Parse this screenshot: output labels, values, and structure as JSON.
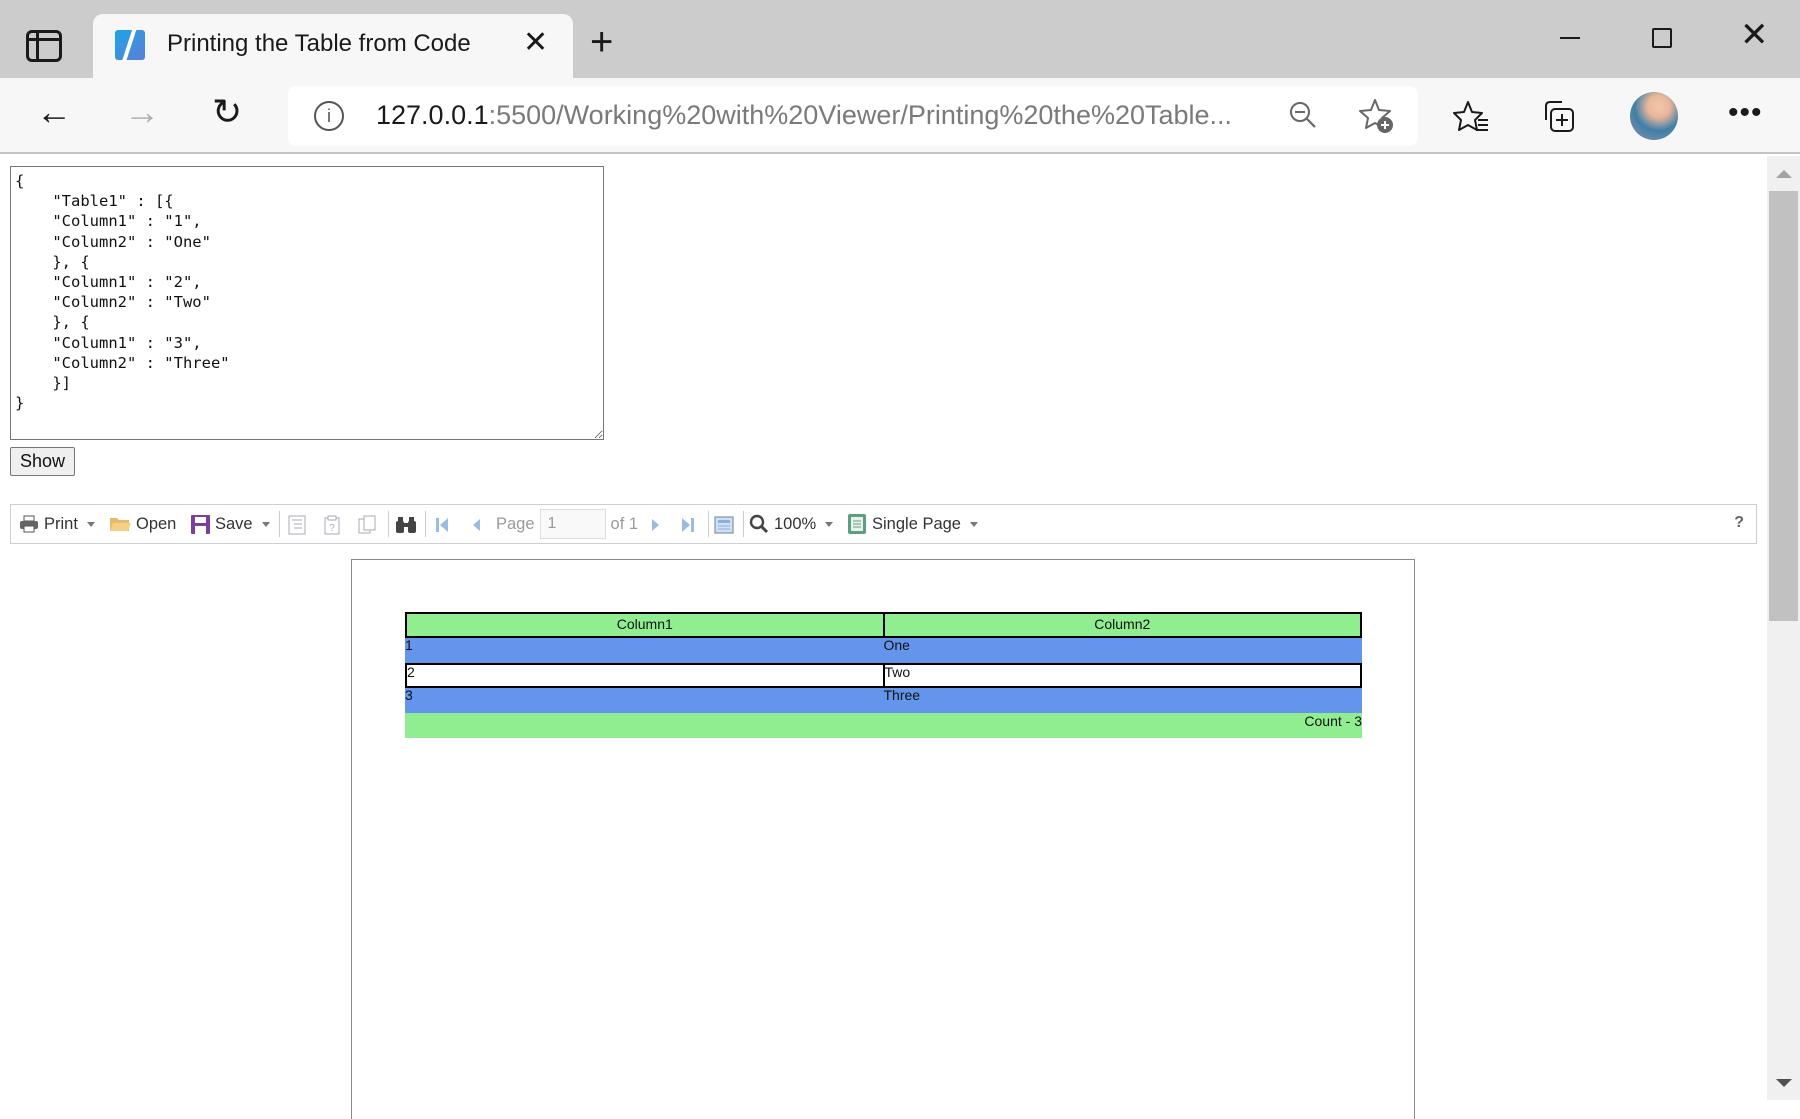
{
  "browser": {
    "tab": {
      "title": "Printing the Table from Code",
      "close_glyph": "✕"
    },
    "new_tab_glyph": "+",
    "window_controls": {
      "close_glyph": "✕"
    },
    "nav": {
      "back_glyph": "←",
      "forward_glyph": "→",
      "reload_glyph": "↻"
    },
    "address": {
      "info_glyph": "i",
      "host": "127.0.0.1",
      "rest": ":5500/Working%20with%20Viewer/Printing%20the%20Table..."
    },
    "more_glyph": "•••"
  },
  "page": {
    "json_input": "{\n    \"Table1\" : [{\n    \"Column1\" : \"1\",\n    \"Column2\" : \"One\"\n    }, {\n    \"Column1\" : \"2\",\n    \"Column2\" : \"Two\"\n    }, {\n    \"Column1\" : \"3\",\n    \"Column2\" : \"Three\"\n    }]\n}",
    "show_button": "Show"
  },
  "viewer_toolbar": {
    "print": "Print",
    "open": "Open",
    "save": "Save",
    "page_label": "Page",
    "page_value": "1",
    "of_label": "of 1",
    "zoom": "100%",
    "view_mode": "Single Page",
    "help": "?"
  },
  "report": {
    "columns": [
      "Column1",
      "Column2"
    ],
    "rows": [
      {
        "c1": "1",
        "c2": "One"
      },
      {
        "c1": "2",
        "c2": "Two"
      },
      {
        "c1": "3",
        "c2": "Three"
      }
    ],
    "footer": "Count - 3",
    "colors": {
      "header": "#90ee90",
      "odd_row": "#6495ed",
      "even_row": "#ffffff",
      "footer": "#90ee90"
    }
  }
}
